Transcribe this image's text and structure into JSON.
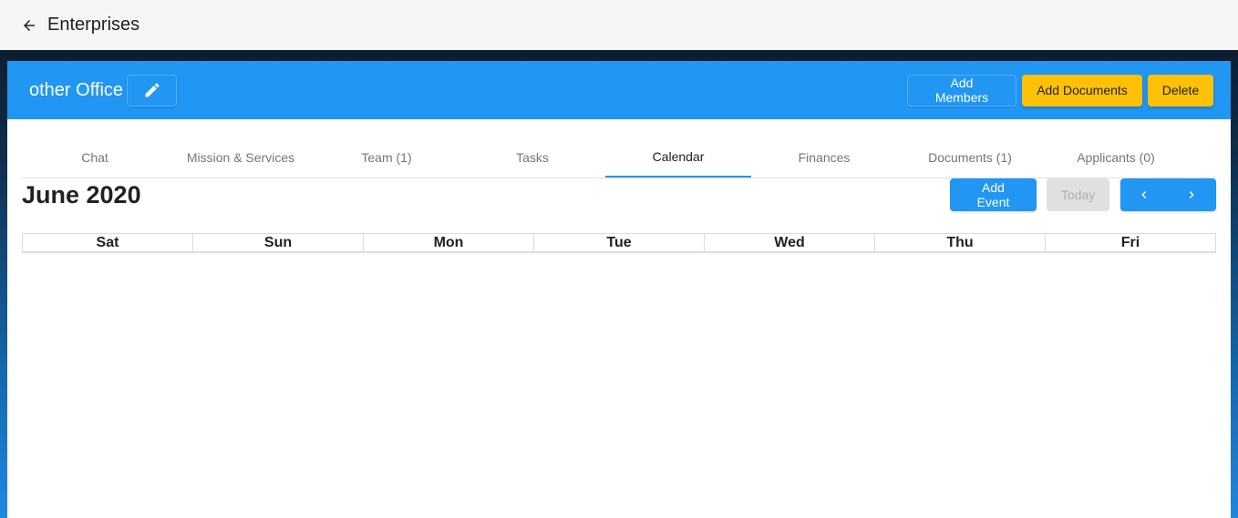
{
  "topbar": {
    "back_icon": "arrow-left-icon",
    "title": "Enterprises"
  },
  "header": {
    "office_name": "other Office",
    "edit_icon": "pencil-icon",
    "add_members_label": "Add Members",
    "add_documents_label": "Add Documents",
    "delete_label": "Delete"
  },
  "tabs": [
    {
      "label": "Chat",
      "active": false
    },
    {
      "label": "Mission & Services",
      "active": false
    },
    {
      "label": "Team (1)",
      "active": false
    },
    {
      "label": "Tasks",
      "active": false
    },
    {
      "label": "Calendar",
      "active": true
    },
    {
      "label": "Finances",
      "active": false
    },
    {
      "label": "Documents (1)",
      "active": false
    },
    {
      "label": "Applicants (0)",
      "active": false
    }
  ],
  "calendar": {
    "month_title": "June 2020",
    "add_event_label": "Add Event",
    "today_label": "Today",
    "prev_icon": "chevron-left-icon",
    "next_icon": "chevron-right-icon",
    "weekdays": [
      "Sat",
      "Sun",
      "Mon",
      "Tue",
      "Wed",
      "Thu",
      "Fri"
    ]
  },
  "colors": {
    "primary": "#2196f3",
    "accent": "#ffc107",
    "topbar_bg": "#f5f5f5"
  }
}
